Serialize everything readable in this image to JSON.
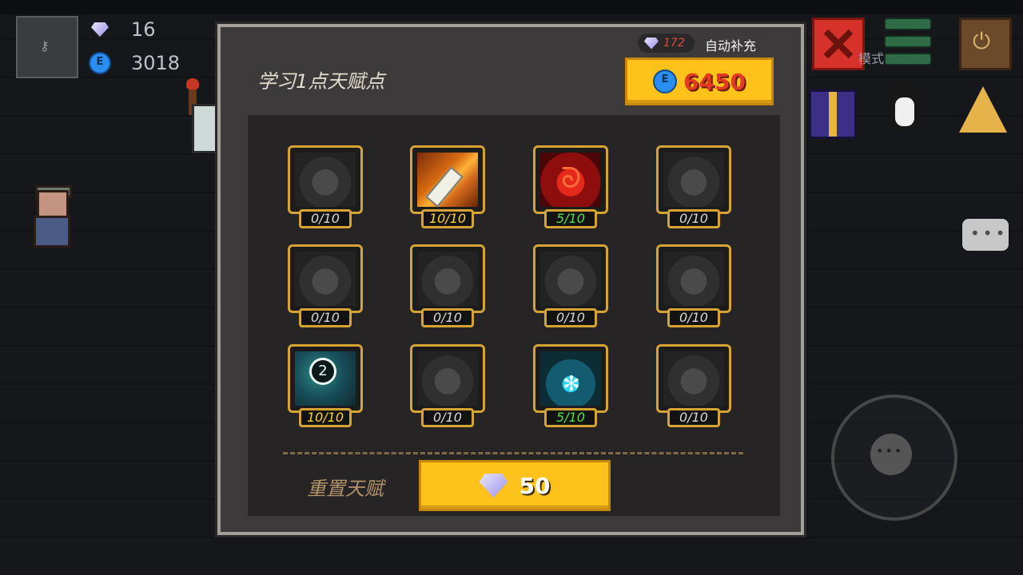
{
  "hud": {
    "gems": "16",
    "coins": "3018"
  },
  "topbar": {
    "mode_label": "模式"
  },
  "dialog": {
    "title": "学习1点天赋点",
    "gem_count": "172",
    "auto_refill_label": "自动补充",
    "cost": "6450",
    "reset_label": "重置天赋",
    "reset_cost": "50"
  },
  "talents": [
    {
      "name": "heart-talent",
      "level": "0/10",
      "state": "locked"
    },
    {
      "name": "sword-talent",
      "level": "10/10",
      "state": "max"
    },
    {
      "name": "fire-talent",
      "level": "5/10",
      "state": "mid"
    },
    {
      "name": "drop-talent",
      "level": "0/10",
      "state": "locked"
    },
    {
      "name": "bubble-talent",
      "level": "0/10",
      "state": "locked"
    },
    {
      "name": "slot-one-talent",
      "level": "0/10",
      "state": "locked"
    },
    {
      "name": "shadow-talent",
      "level": "0/10",
      "state": "locked"
    },
    {
      "name": "lightning-talent",
      "level": "0/10",
      "state": "locked"
    },
    {
      "name": "slot-two-talent",
      "level": "10/10",
      "state": "max"
    },
    {
      "name": "slot-three-talent",
      "level": "0/10",
      "state": "locked"
    },
    {
      "name": "frost-talent",
      "level": "5/10",
      "state": "mid"
    },
    {
      "name": "eye-talent",
      "level": "0/10",
      "state": "locked"
    }
  ]
}
